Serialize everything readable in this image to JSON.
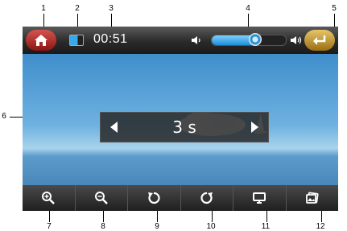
{
  "callouts": [
    "1",
    "2",
    "3",
    "4",
    "5",
    "6",
    "7",
    "8",
    "9",
    "10",
    "11",
    "12"
  ],
  "status": {
    "time": "00:51",
    "volume_fraction": 0.6
  },
  "slideshow": {
    "interval": "3 s"
  },
  "icons": {
    "home": "home-icon",
    "battery": "battery-icon",
    "volume_down": "volume-down-icon",
    "volume_up": "volume-up-icon",
    "back": "back-icon",
    "zoom_in": "zoom-in-icon",
    "zoom_out": "zoom-out-icon",
    "rotate_left": "rotate-left-icon",
    "rotate_right": "rotate-right-icon",
    "display": "display-icon",
    "gallery": "gallery-icon"
  },
  "colors": {
    "home_button": "#b52a26",
    "back_button": "#c9a038",
    "volume_fill": "#3aa7e8"
  }
}
